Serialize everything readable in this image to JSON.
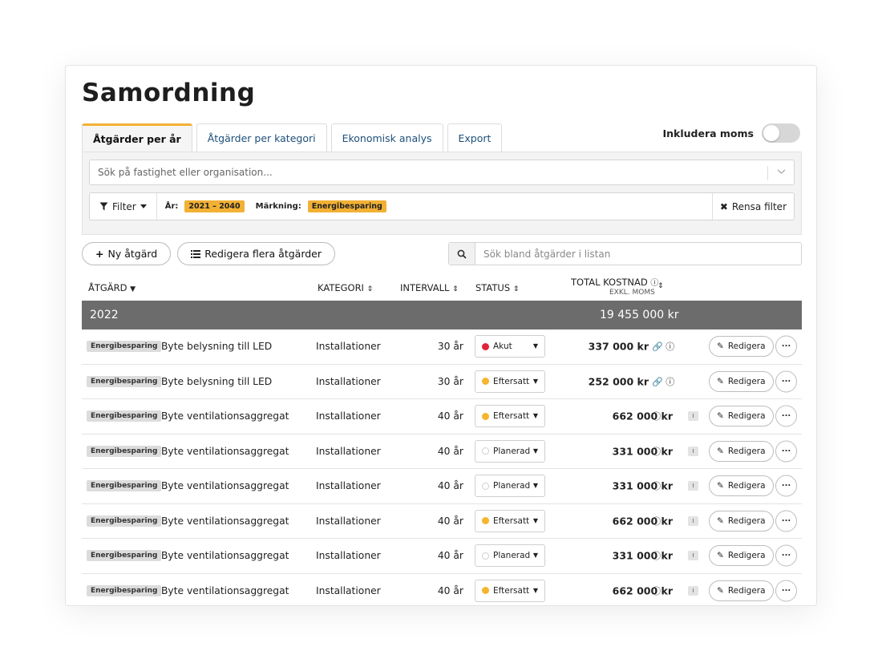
{
  "page": {
    "title": "Samordning"
  },
  "tabs": [
    {
      "label": "Åtgärder per år",
      "active": true
    },
    {
      "label": "Åtgärder per kategori",
      "active": false
    },
    {
      "label": "Ekonomisk analys",
      "active": false
    },
    {
      "label": "Export",
      "active": false
    }
  ],
  "moms_toggle": {
    "label": "Inkludera moms",
    "on": false
  },
  "search_main": {
    "placeholder": "Sök på fastighet eller organisation..."
  },
  "filter": {
    "button_label": "Filter",
    "year_label": "År:",
    "year_value": "2021 – 2040",
    "marking_label": "Märkning:",
    "marking_value": "Energibesparing",
    "clear_label": "Rensa filter"
  },
  "actions": {
    "new_label": "Ny åtgärd",
    "edit_many_label": "Redigera flera åtgärder",
    "search_placeholder": "Sök bland åtgärder i listan"
  },
  "columns": {
    "atgard": "ÅTGÄRD",
    "kategori": "KATEGORI",
    "intervall": "INTERVALL",
    "status": "STATUS",
    "total": "TOTAL KOSTNAD",
    "total_sub": "EXKL. MOMS"
  },
  "group": {
    "year": "2022",
    "total": "19 455 000 kr"
  },
  "colors": {
    "accent": "#f2b134",
    "akut": "#e0243c",
    "eftersatt": "#f5b52e",
    "group_bg": "#6c6c6c"
  },
  "rows": [
    {
      "tag": "Energibesparing",
      "name": "Byte belysning till LED",
      "category": "Installationer",
      "interval": "30 år",
      "status": "Akut",
      "status_color": "#e0243c",
      "cost": "337 000 kr",
      "linked": true,
      "edit": "Redigera"
    },
    {
      "tag": "Energibesparing",
      "name": "Byte belysning till LED",
      "category": "Installationer",
      "interval": "30 år",
      "status": "Eftersatt",
      "status_color": "#f5b52e",
      "cost": "252 000 kr",
      "linked": true,
      "edit": "Redigera"
    },
    {
      "tag": "Energibesparing",
      "name": "Byte ventilationsaggregat",
      "category": "Installationer",
      "interval": "40 år",
      "status": "Eftersatt",
      "status_color": "#f5b52e",
      "cost": "662 000 kr",
      "linked": false,
      "edit": "Redigera"
    },
    {
      "tag": "Energibesparing",
      "name": "Byte ventilationsaggregat",
      "category": "Installationer",
      "interval": "40 år",
      "status": "Planerad",
      "status_color": "",
      "cost": "331 000 kr",
      "linked": false,
      "edit": "Redigera"
    },
    {
      "tag": "Energibesparing",
      "name": "Byte ventilationsaggregat",
      "category": "Installationer",
      "interval": "40 år",
      "status": "Planerad",
      "status_color": "",
      "cost": "331 000 kr",
      "linked": false,
      "edit": "Redigera"
    },
    {
      "tag": "Energibesparing",
      "name": "Byte ventilationsaggregat",
      "category": "Installationer",
      "interval": "40 år",
      "status": "Eftersatt",
      "status_color": "#f5b52e",
      "cost": "662 000 kr",
      "linked": false,
      "edit": "Redigera"
    },
    {
      "tag": "Energibesparing",
      "name": "Byte ventilationsaggregat",
      "category": "Installationer",
      "interval": "40 år",
      "status": "Planerad",
      "status_color": "",
      "cost": "331 000 kr",
      "linked": false,
      "edit": "Redigera"
    },
    {
      "tag": "Energibesparing",
      "name": "Byte ventilationsaggregat",
      "category": "Installationer",
      "interval": "40 år",
      "status": "Eftersatt",
      "status_color": "#f5b52e",
      "cost": "662 000 kr",
      "linked": false,
      "edit": "Redigera"
    }
  ]
}
